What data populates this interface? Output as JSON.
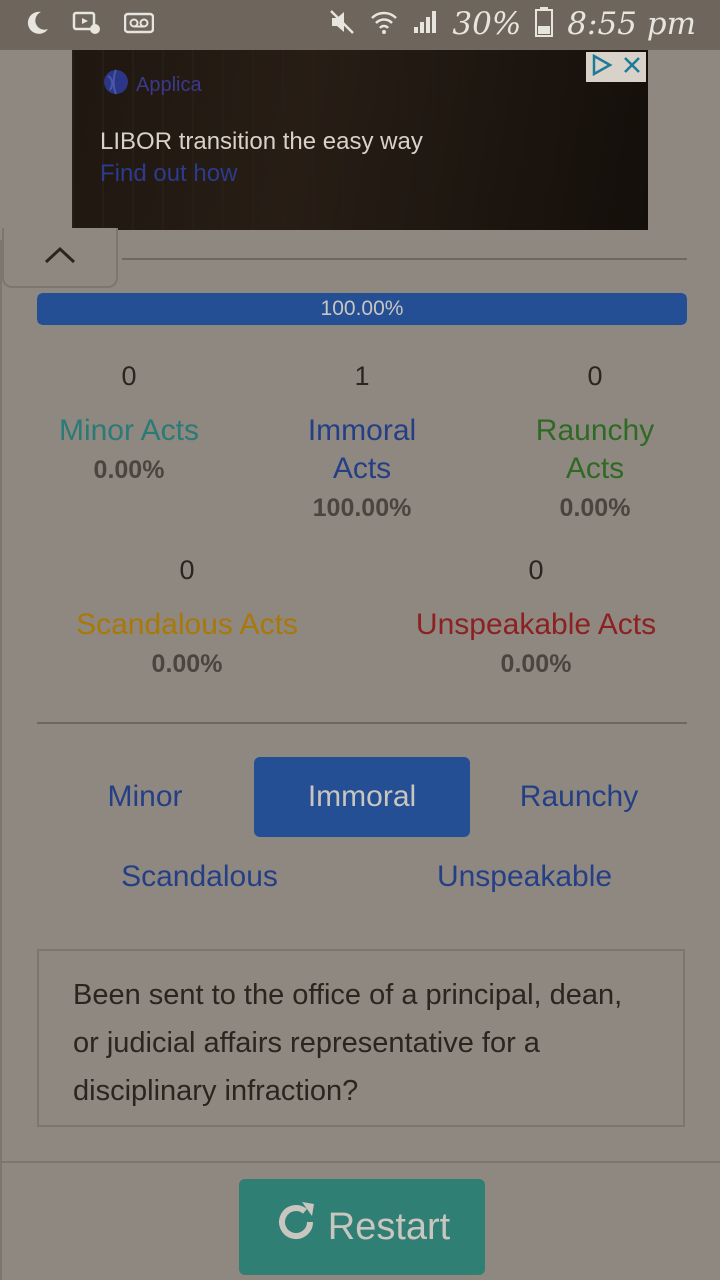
{
  "status_bar": {
    "battery": "30%",
    "time": "8:55 pm",
    "icons": [
      "moon-icon",
      "media-icon",
      "voicemail-icon",
      "mute-icon",
      "wifi-icon",
      "signal-icon",
      "battery-icon"
    ]
  },
  "ad": {
    "brand": "Applica",
    "title": "LIBOR transition the easy way",
    "link": "Find out how"
  },
  "progress": {
    "value": 100,
    "label": "100.00%"
  },
  "stats": [
    {
      "count": "0",
      "label": "Minor Acts",
      "pct": "0.00%",
      "color": "#2a7a78"
    },
    {
      "count": "1",
      "label": "Immoral Acts",
      "pct": "100.00%",
      "color": "#253f86"
    },
    {
      "count": "0",
      "label": "Raunchy Acts",
      "pct": "0.00%",
      "color": "#2f6a25"
    },
    {
      "count": "0",
      "label": "Scandalous Acts",
      "pct": "0.00%",
      "color": "#a87808"
    },
    {
      "count": "0",
      "label": "Unspeakable Acts",
      "pct": "0.00%",
      "color": "#8c2121"
    }
  ],
  "categories": [
    {
      "label": "Minor",
      "active": false
    },
    {
      "label": "Immoral",
      "active": true
    },
    {
      "label": "Raunchy",
      "active": false
    },
    {
      "label": "Scandalous",
      "active": false
    },
    {
      "label": "Unspeakable",
      "active": false
    }
  ],
  "question": "Been sent to the office of a principal, dean, or judicial affairs representative for a disciplinary infraction?",
  "restart_label": "Restart"
}
